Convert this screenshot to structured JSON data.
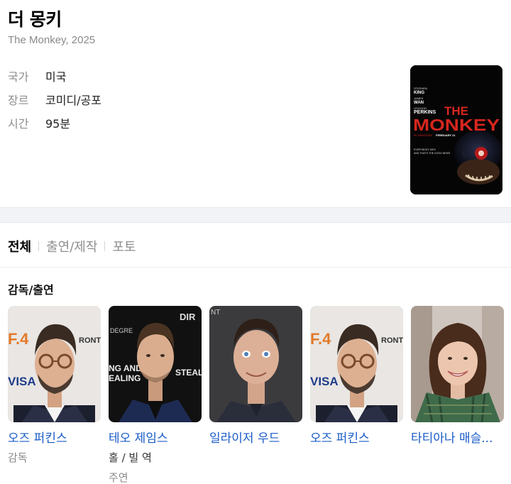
{
  "movie": {
    "title": "더 몽키",
    "subtitle": "The Monkey, 2025",
    "info": [
      {
        "label": "국가",
        "value": "미국"
      },
      {
        "label": "장르",
        "value": "코미디/공포"
      },
      {
        "label": "시간",
        "value": "95분"
      }
    ],
    "poster": {
      "credit1_small": "STEPHEN",
      "credit1": "KING",
      "credit2_small": "JAMES",
      "credit2": "WAN",
      "credit3_small": "OSGOOD",
      "credit3": "PERKINS",
      "title_the": "THE",
      "title_monkey": "MONKEY",
      "release_prefix": "IN THEATERS",
      "release_date": "FEBRUARY 21",
      "tagline1": "EVERYBODY DIES",
      "tagline2": "AND THAT'S THE GOOD NEWS",
      "accent_color": "#d7261e"
    }
  },
  "tabs": [
    {
      "label": "전체",
      "active": true
    },
    {
      "label": "출연/제작",
      "active": false
    },
    {
      "label": "포토",
      "active": false
    }
  ],
  "cast_section": {
    "title": "감독/출연",
    "people": [
      {
        "name": "오즈 퍼킨스",
        "role": "",
        "type": "감독"
      },
      {
        "name": "테오 제임스",
        "role": "홀 / 빌 역",
        "type": "주연"
      },
      {
        "name": "일라이저 우드",
        "role": "",
        "type": ""
      },
      {
        "name": "오즈 퍼킨스",
        "role": "",
        "type": ""
      },
      {
        "name": "타티아나 매슬...",
        "role": "",
        "type": ""
      }
    ],
    "backdrop_text": {
      "tiff": "F.4",
      "toronto": "RONTO",
      "visa": "VISA",
      "degree": "DEGRE",
      "direct": "DIR",
      "ing": "NG AND",
      "ealing": "EALING",
      "steal": "STEAL",
      "nt": "NT"
    }
  }
}
